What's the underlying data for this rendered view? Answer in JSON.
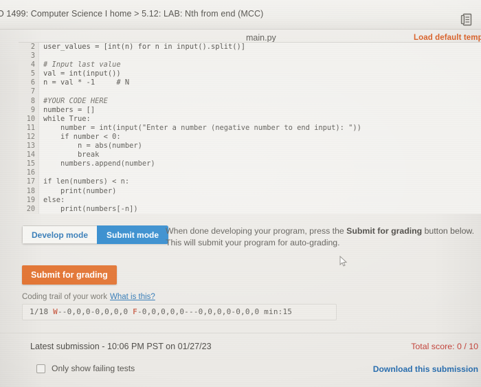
{
  "header": {
    "breadcrumb": "O 1499: Computer Science I home > 5.12: LAB: Nth from end (MCC)",
    "notes_icon": "notes-icon"
  },
  "editor": {
    "filename": "main.py",
    "load_template_label": "Load default templ",
    "lines": [
      {
        "num": "2",
        "text": "user_values = [int(n) for n in input().split()]",
        "comment": false
      },
      {
        "num": "3",
        "text": "",
        "comment": false
      },
      {
        "num": "4",
        "text": "# Input last value",
        "comment": true
      },
      {
        "num": "5",
        "text": "val = int(input())",
        "comment": false
      },
      {
        "num": "6",
        "text": "n = val * -1     # N",
        "comment": false
      },
      {
        "num": "7",
        "text": "",
        "comment": false
      },
      {
        "num": "8",
        "text": "#YOUR CODE HERE",
        "comment": true
      },
      {
        "num": "9",
        "text": "numbers = []",
        "comment": false
      },
      {
        "num": "10",
        "text": "while True:",
        "comment": false
      },
      {
        "num": "11",
        "text": "    number = int(input(\"Enter a number (negative number to end input): \"))",
        "comment": false
      },
      {
        "num": "12",
        "text": "    if number < 0:",
        "comment": false
      },
      {
        "num": "13",
        "text": "        n = abs(number)",
        "comment": false
      },
      {
        "num": "14",
        "text": "        break",
        "comment": false
      },
      {
        "num": "15",
        "text": "    numbers.append(number)",
        "comment": false
      },
      {
        "num": "16",
        "text": "",
        "comment": false
      },
      {
        "num": "17",
        "text": "if len(numbers) < n:",
        "comment": false
      },
      {
        "num": "18",
        "text": "    print(number)",
        "comment": false
      },
      {
        "num": "19",
        "text": "else:",
        "comment": false
      },
      {
        "num": "20",
        "text": "    print(numbers[-n])",
        "comment": false
      }
    ]
  },
  "modes": {
    "develop_label": "Develop mode",
    "submit_label": "Submit mode",
    "active": "Submit mode",
    "active_color": "#2b87cc"
  },
  "instruction": {
    "before": "When done developing your program, press the ",
    "bold": "Submit for grading",
    "after": " button below. This will submit your program for auto-grading."
  },
  "submit": {
    "label": "Submit for grading",
    "color": "#e2712e"
  },
  "coding_trail": {
    "label": "Coding trail of your work",
    "link_label": "What is this?",
    "count": "1/18",
    "mark_w": "W",
    "segment_w": "--0,0,0-0,0,0,0",
    "mark_f": "F",
    "segment_f": "-0,0,0,0,0---0,0,0,0-0,0,0",
    "minutes": "min:15",
    "mark_color": "#cc6a55"
  },
  "submission": {
    "title": "Latest submission - 10:06 PM PST on 01/27/23",
    "total_score": "Total score: 0 / 10",
    "score_color": "#c4453c",
    "failing_label": "Only show failing tests",
    "download_label": "Download this submission"
  }
}
